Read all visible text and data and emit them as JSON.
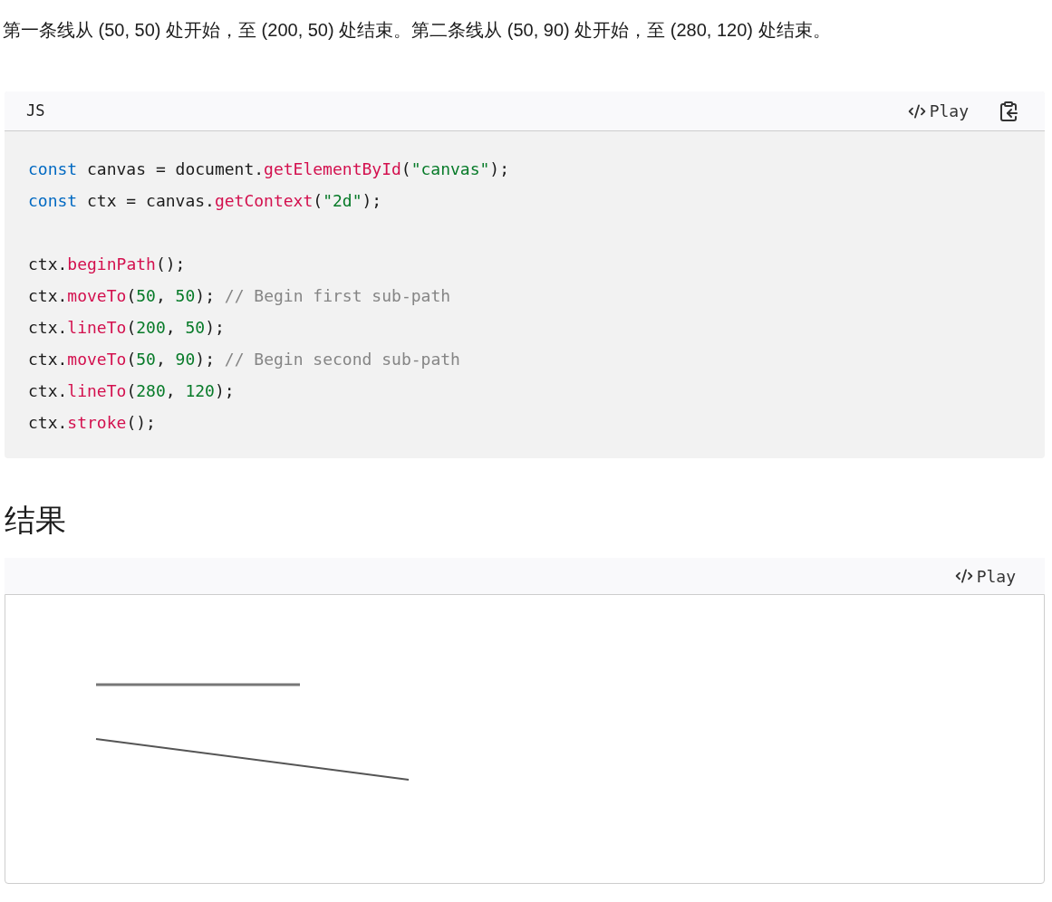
{
  "intro": "第一条线从 (50, 50) 处开始，至 (200, 50) 处结束。第二条线从 (50, 90) 处开始，至 (280, 120) 处结束。",
  "code_block": {
    "language": "JS",
    "play": "Play",
    "groups": [
      [
        [
          {
            "kind": "keyword",
            "text": "const"
          },
          {
            "kind": "plain",
            "text": " canvas = document."
          },
          {
            "kind": "function",
            "text": "getElementById"
          },
          {
            "kind": "plain",
            "text": "("
          },
          {
            "kind": "string",
            "text": "\"canvas\""
          },
          {
            "kind": "plain",
            "text": ");"
          }
        ],
        [
          {
            "kind": "keyword",
            "text": "const"
          },
          {
            "kind": "plain",
            "text": " ctx = canvas."
          },
          {
            "kind": "function",
            "text": "getContext"
          },
          {
            "kind": "plain",
            "text": "("
          },
          {
            "kind": "string",
            "text": "\"2d\""
          },
          {
            "kind": "plain",
            "text": ");"
          }
        ]
      ],
      [
        [
          {
            "kind": "plain",
            "text": "ctx."
          },
          {
            "kind": "function",
            "text": "beginPath"
          },
          {
            "kind": "plain",
            "text": "();"
          }
        ],
        [
          {
            "kind": "plain",
            "text": "ctx."
          },
          {
            "kind": "function",
            "text": "moveTo"
          },
          {
            "kind": "plain",
            "text": "("
          },
          {
            "kind": "number",
            "text": "50"
          },
          {
            "kind": "plain",
            "text": ", "
          },
          {
            "kind": "number",
            "text": "50"
          },
          {
            "kind": "plain",
            "text": "); "
          },
          {
            "kind": "comment",
            "text": "// Begin first sub-path"
          }
        ],
        [
          {
            "kind": "plain",
            "text": "ctx."
          },
          {
            "kind": "function",
            "text": "lineTo"
          },
          {
            "kind": "plain",
            "text": "("
          },
          {
            "kind": "number",
            "text": "200"
          },
          {
            "kind": "plain",
            "text": ", "
          },
          {
            "kind": "number",
            "text": "50"
          },
          {
            "kind": "plain",
            "text": ");"
          }
        ],
        [
          {
            "kind": "plain",
            "text": "ctx."
          },
          {
            "kind": "function",
            "text": "moveTo"
          },
          {
            "kind": "plain",
            "text": "("
          },
          {
            "kind": "number",
            "text": "50"
          },
          {
            "kind": "plain",
            "text": ", "
          },
          {
            "kind": "number",
            "text": "90"
          },
          {
            "kind": "plain",
            "text": "); "
          },
          {
            "kind": "comment",
            "text": "// Begin second sub-path"
          }
        ],
        [
          {
            "kind": "plain",
            "text": "ctx."
          },
          {
            "kind": "function",
            "text": "lineTo"
          },
          {
            "kind": "plain",
            "text": "("
          },
          {
            "kind": "number",
            "text": "280"
          },
          {
            "kind": "plain",
            "text": ", "
          },
          {
            "kind": "number",
            "text": "120"
          },
          {
            "kind": "plain",
            "text": ");"
          }
        ],
        [
          {
            "kind": "plain",
            "text": "ctx."
          },
          {
            "kind": "function",
            "text": "stroke"
          },
          {
            "kind": "plain",
            "text": "();"
          }
        ]
      ]
    ]
  },
  "heading": "结果",
  "result": {
    "play": "Play"
  }
}
